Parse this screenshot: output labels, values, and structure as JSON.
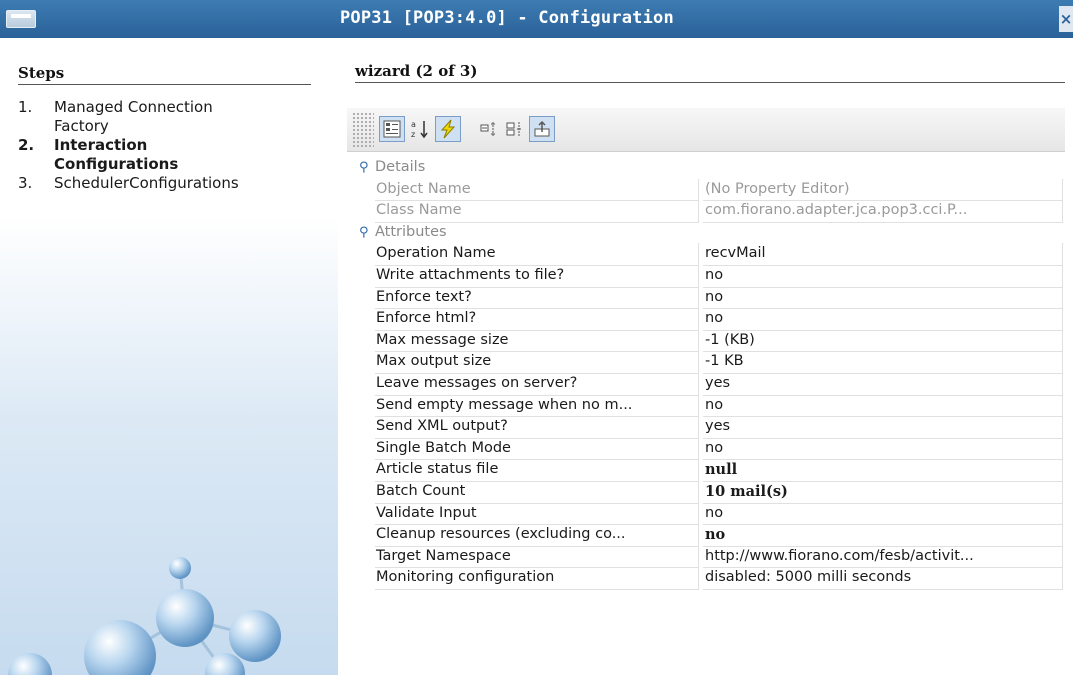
{
  "window": {
    "title": "POP31 [POP3:4.0] - Configuration",
    "close_glyph": "×"
  },
  "steps": {
    "heading": "Steps",
    "items": [
      {
        "num": "1.",
        "label": "Managed Connection",
        "label2": "Factory"
      },
      {
        "num": "2.",
        "label": "Interaction",
        "label2": "Configurations"
      },
      {
        "num": "3.",
        "label": "SchedulerConfigurations"
      }
    ]
  },
  "wizard": {
    "heading": "wizard (2 of 3)"
  },
  "toolbar": {
    "icons": [
      "categorized-view-icon",
      "sort-alphabetical-icon",
      "lightning-icon",
      "expand-icon",
      "collapse-icon",
      "export-icon"
    ]
  },
  "sheet": {
    "details": {
      "label": "Details",
      "rows": [
        {
          "name": "Object Name",
          "value": "(No Property Editor)"
        },
        {
          "name": "Class Name",
          "value": "com.fiorano.adapter.jca.pop3.cci.P..."
        }
      ]
    },
    "attributes": {
      "label": "Attributes",
      "rows": [
        {
          "name": "Operation Name",
          "value": "recvMail"
        },
        {
          "name": "Write attachments to file?",
          "value": "no"
        },
        {
          "name": "Enforce text?",
          "value": "no"
        },
        {
          "name": "Enforce html?",
          "value": "no"
        },
        {
          "name": "Max message size",
          "value": "-1  (KB)"
        },
        {
          "name": "Max output size",
          "value": "-1  KB"
        },
        {
          "name": "Leave messages on server?",
          "value": "yes"
        },
        {
          "name": "Send empty message when no m...",
          "value": "no"
        },
        {
          "name": "Send XML output?",
          "value": "yes"
        },
        {
          "name": "Single Batch Mode",
          "value": "no"
        },
        {
          "name": "Article status file",
          "value": "null"
        },
        {
          "name": "Batch Count",
          "value": "10 mail(s)"
        },
        {
          "name": "Validate Input",
          "value": "no"
        },
        {
          "name": "Cleanup resources (excluding co...",
          "value": "no"
        },
        {
          "name": "Target Namespace",
          "value": "http://www.fiorano.com/fesb/activit..."
        },
        {
          "name": "Monitoring configuration",
          "value": "disabled: 5000 milli seconds"
        }
      ]
    }
  }
}
